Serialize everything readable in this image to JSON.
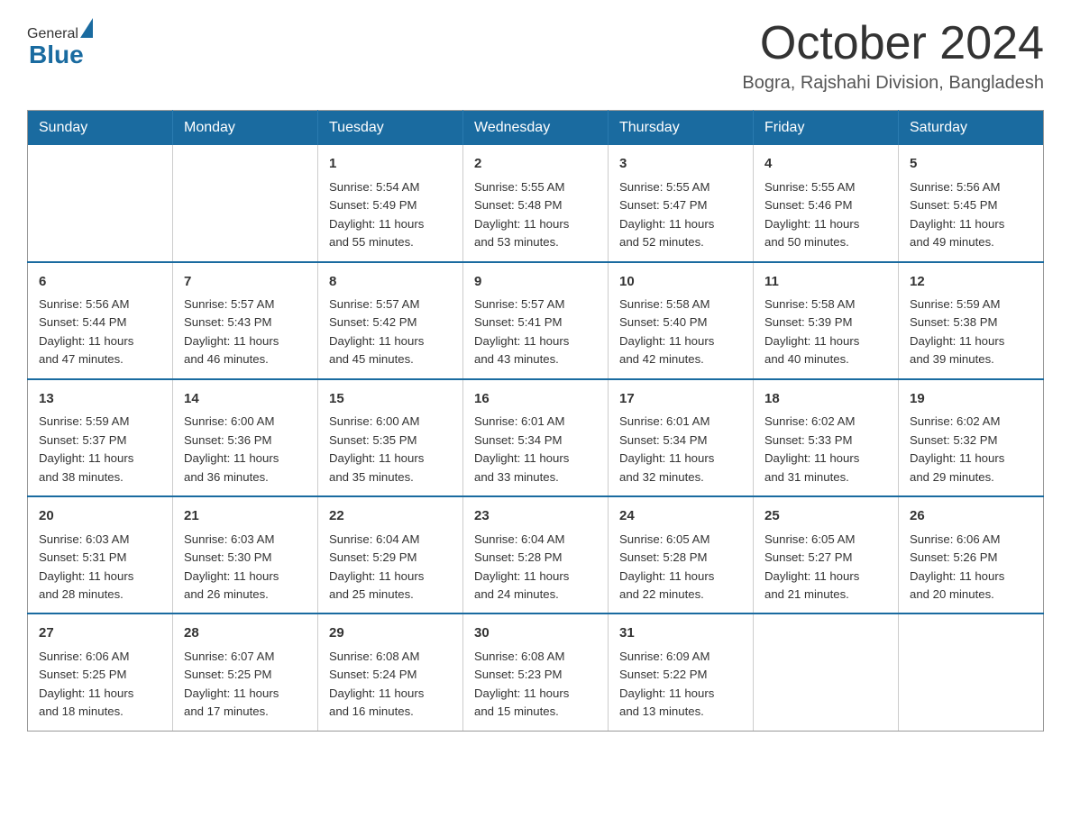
{
  "logo": {
    "general": "General",
    "blue": "Blue"
  },
  "title": "October 2024",
  "subtitle": "Bogra, Rajshahi Division, Bangladesh",
  "weekdays": [
    "Sunday",
    "Monday",
    "Tuesday",
    "Wednesday",
    "Thursday",
    "Friday",
    "Saturday"
  ],
  "weeks": [
    [
      {
        "day": "",
        "info": ""
      },
      {
        "day": "",
        "info": ""
      },
      {
        "day": "1",
        "info": "Sunrise: 5:54 AM\nSunset: 5:49 PM\nDaylight: 11 hours\nand 55 minutes."
      },
      {
        "day": "2",
        "info": "Sunrise: 5:55 AM\nSunset: 5:48 PM\nDaylight: 11 hours\nand 53 minutes."
      },
      {
        "day": "3",
        "info": "Sunrise: 5:55 AM\nSunset: 5:47 PM\nDaylight: 11 hours\nand 52 minutes."
      },
      {
        "day": "4",
        "info": "Sunrise: 5:55 AM\nSunset: 5:46 PM\nDaylight: 11 hours\nand 50 minutes."
      },
      {
        "day": "5",
        "info": "Sunrise: 5:56 AM\nSunset: 5:45 PM\nDaylight: 11 hours\nand 49 minutes."
      }
    ],
    [
      {
        "day": "6",
        "info": "Sunrise: 5:56 AM\nSunset: 5:44 PM\nDaylight: 11 hours\nand 47 minutes."
      },
      {
        "day": "7",
        "info": "Sunrise: 5:57 AM\nSunset: 5:43 PM\nDaylight: 11 hours\nand 46 minutes."
      },
      {
        "day": "8",
        "info": "Sunrise: 5:57 AM\nSunset: 5:42 PM\nDaylight: 11 hours\nand 45 minutes."
      },
      {
        "day": "9",
        "info": "Sunrise: 5:57 AM\nSunset: 5:41 PM\nDaylight: 11 hours\nand 43 minutes."
      },
      {
        "day": "10",
        "info": "Sunrise: 5:58 AM\nSunset: 5:40 PM\nDaylight: 11 hours\nand 42 minutes."
      },
      {
        "day": "11",
        "info": "Sunrise: 5:58 AM\nSunset: 5:39 PM\nDaylight: 11 hours\nand 40 minutes."
      },
      {
        "day": "12",
        "info": "Sunrise: 5:59 AM\nSunset: 5:38 PM\nDaylight: 11 hours\nand 39 minutes."
      }
    ],
    [
      {
        "day": "13",
        "info": "Sunrise: 5:59 AM\nSunset: 5:37 PM\nDaylight: 11 hours\nand 38 minutes."
      },
      {
        "day": "14",
        "info": "Sunrise: 6:00 AM\nSunset: 5:36 PM\nDaylight: 11 hours\nand 36 minutes."
      },
      {
        "day": "15",
        "info": "Sunrise: 6:00 AM\nSunset: 5:35 PM\nDaylight: 11 hours\nand 35 minutes."
      },
      {
        "day": "16",
        "info": "Sunrise: 6:01 AM\nSunset: 5:34 PM\nDaylight: 11 hours\nand 33 minutes."
      },
      {
        "day": "17",
        "info": "Sunrise: 6:01 AM\nSunset: 5:34 PM\nDaylight: 11 hours\nand 32 minutes."
      },
      {
        "day": "18",
        "info": "Sunrise: 6:02 AM\nSunset: 5:33 PM\nDaylight: 11 hours\nand 31 minutes."
      },
      {
        "day": "19",
        "info": "Sunrise: 6:02 AM\nSunset: 5:32 PM\nDaylight: 11 hours\nand 29 minutes."
      }
    ],
    [
      {
        "day": "20",
        "info": "Sunrise: 6:03 AM\nSunset: 5:31 PM\nDaylight: 11 hours\nand 28 minutes."
      },
      {
        "day": "21",
        "info": "Sunrise: 6:03 AM\nSunset: 5:30 PM\nDaylight: 11 hours\nand 26 minutes."
      },
      {
        "day": "22",
        "info": "Sunrise: 6:04 AM\nSunset: 5:29 PM\nDaylight: 11 hours\nand 25 minutes."
      },
      {
        "day": "23",
        "info": "Sunrise: 6:04 AM\nSunset: 5:28 PM\nDaylight: 11 hours\nand 24 minutes."
      },
      {
        "day": "24",
        "info": "Sunrise: 6:05 AM\nSunset: 5:28 PM\nDaylight: 11 hours\nand 22 minutes."
      },
      {
        "day": "25",
        "info": "Sunrise: 6:05 AM\nSunset: 5:27 PM\nDaylight: 11 hours\nand 21 minutes."
      },
      {
        "day": "26",
        "info": "Sunrise: 6:06 AM\nSunset: 5:26 PM\nDaylight: 11 hours\nand 20 minutes."
      }
    ],
    [
      {
        "day": "27",
        "info": "Sunrise: 6:06 AM\nSunset: 5:25 PM\nDaylight: 11 hours\nand 18 minutes."
      },
      {
        "day": "28",
        "info": "Sunrise: 6:07 AM\nSunset: 5:25 PM\nDaylight: 11 hours\nand 17 minutes."
      },
      {
        "day": "29",
        "info": "Sunrise: 6:08 AM\nSunset: 5:24 PM\nDaylight: 11 hours\nand 16 minutes."
      },
      {
        "day": "30",
        "info": "Sunrise: 6:08 AM\nSunset: 5:23 PM\nDaylight: 11 hours\nand 15 minutes."
      },
      {
        "day": "31",
        "info": "Sunrise: 6:09 AM\nSunset: 5:22 PM\nDaylight: 11 hours\nand 13 minutes."
      },
      {
        "day": "",
        "info": ""
      },
      {
        "day": "",
        "info": ""
      }
    ]
  ]
}
